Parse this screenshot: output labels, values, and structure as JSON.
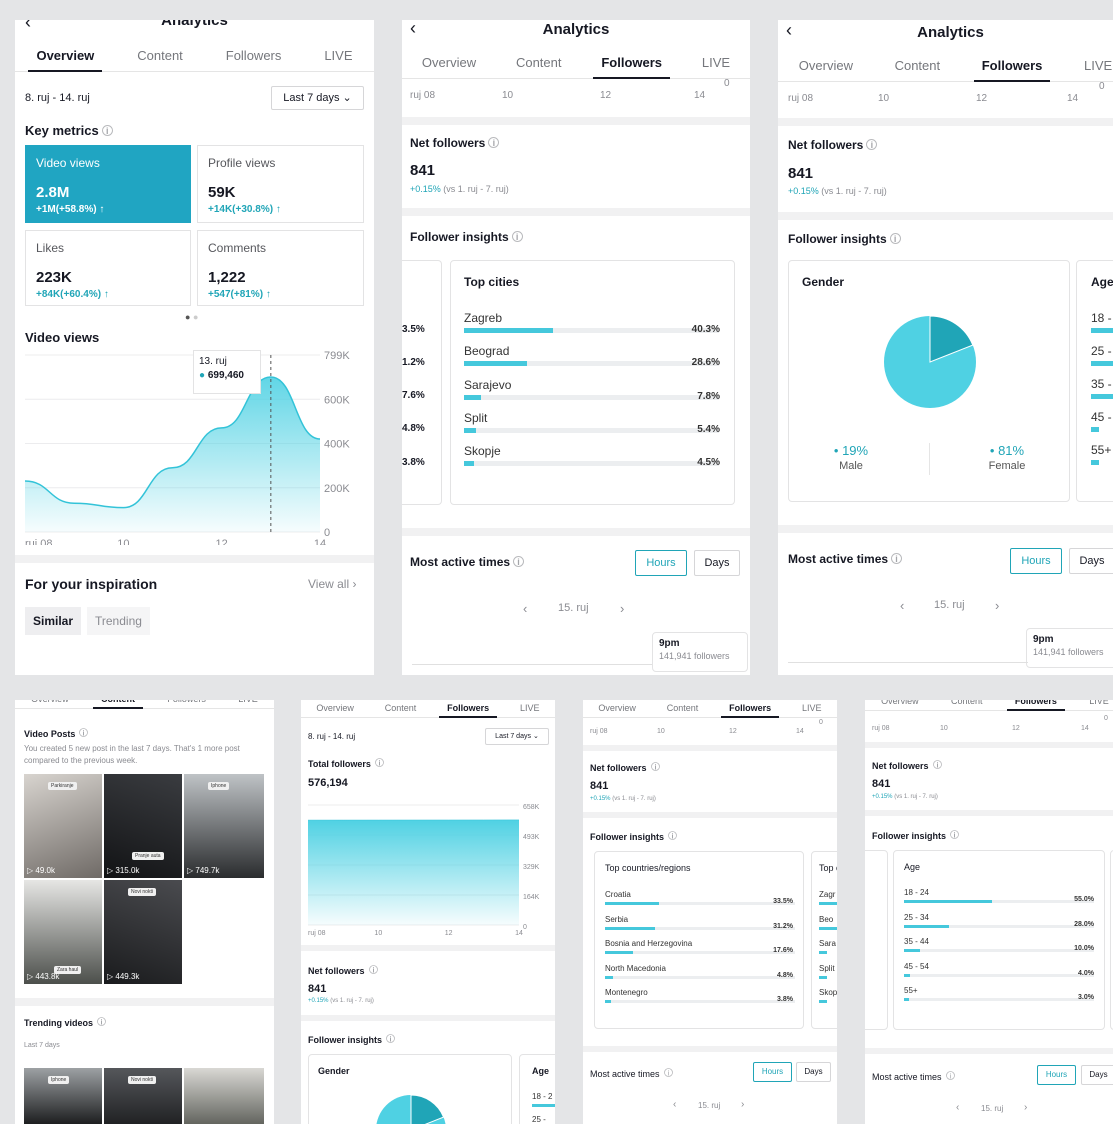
{
  "common": {
    "title": "Analytics",
    "tabs": [
      "Overview",
      "Content",
      "Followers",
      "LIVE"
    ],
    "date_range": "8. ruj - 14. ruj",
    "period_select": "Last 7 days",
    "net_followers_title": "Net followers",
    "net_followers_value": "841",
    "net_followers_pct": "+0.15%",
    "net_followers_vs": " (vs 1. ruj - 7. ruj)",
    "follower_insights_title": "Follower insights",
    "most_active_title": "Most active times",
    "hours_label": "Hours",
    "days_label": "Days",
    "active_date": "15. ruj",
    "active_tooltip_time": "9pm",
    "active_tooltip_followers": "141,941 followers",
    "axis_x": [
      "ruj 08",
      "10",
      "12",
      "14"
    ],
    "axis_zero": "0"
  },
  "overview": {
    "key_metrics_title": "Key metrics",
    "metrics": [
      {
        "label": "Video views",
        "value": "2.8M",
        "change": "+1M(+58.8%) ↑"
      },
      {
        "label": "Profile views",
        "value": "59K",
        "change": "+14K(+30.8%) ↑"
      },
      {
        "label": "Likes",
        "value": "223K",
        "change": "+84K(+60.4%) ↑"
      },
      {
        "label": "Comments",
        "value": "1,222",
        "change": "+547(+81%) ↑"
      }
    ],
    "chart_title": "Video views",
    "y_ticks": [
      "799K",
      "600K",
      "400K",
      "200K",
      "0"
    ],
    "tooltip_date": "13. ruj",
    "tooltip_value": "699,460",
    "inspiration_title": "For your inspiration",
    "view_all": "View all ›",
    "chip_similar": "Similar",
    "chip_trending": "Trending"
  },
  "cities": {
    "title": "Top cities",
    "left_pcts": [
      "3.5%",
      "1.2%",
      "7.6%",
      "4.8%",
      "3.8%"
    ],
    "rows": [
      {
        "name": "Zagreb",
        "pct": "40.3%",
        "share": 0.403
      },
      {
        "name": "Beograd",
        "pct": "28.6%",
        "share": 0.286
      },
      {
        "name": "Sarajevo",
        "pct": "7.8%",
        "share": 0.078
      },
      {
        "name": "Split",
        "pct": "5.4%",
        "share": 0.054
      },
      {
        "name": "Skopje",
        "pct": "4.5%",
        "share": 0.045
      }
    ]
  },
  "gender": {
    "title": "Gender",
    "male_pct": "19%",
    "male_label": "Male",
    "female_pct": "81%",
    "female_label": "Female",
    "male_share": 0.19,
    "age_title": "Age",
    "age_peek": [
      "18 -",
      "25 -",
      "35 -",
      "45 -",
      "55+"
    ]
  },
  "content": {
    "video_posts_title": "Video Posts",
    "video_posts_desc": "You created 5 new post in the last 7 days. That's 1 more post compared to the previous week.",
    "videos": [
      {
        "views": "▷ 49.0k",
        "tag": "Parkiranje"
      },
      {
        "views": "▷ 315.0k",
        "tag": "Pranje auta"
      },
      {
        "views": "▷ 749.7k",
        "tag": "Iphone"
      },
      {
        "views": "▷ 443.8k",
        "tag": "Zara haul"
      },
      {
        "views": "▷ 449.3k",
        "tag": "Novi nokti"
      }
    ],
    "trending_title": "Trending videos",
    "trending_sub": "Last 7 days",
    "trending_tags": [
      "Iphone",
      "Novi nokti",
      ""
    ]
  },
  "total_followers": {
    "title": "Total followers",
    "value": "576,194",
    "y_ticks": [
      "658K",
      "493K",
      "329K",
      "164K",
      "0"
    ],
    "age_peek": [
      "18 - 2",
      "25 -"
    ]
  },
  "countries": {
    "title": "Top countries/regions",
    "rows": [
      {
        "name": "Croatia",
        "pct": "33.5%",
        "share": 0.335
      },
      {
        "name": "Serbia",
        "pct": "31.2%",
        "share": 0.312
      },
      {
        "name": "Bosnia and Herzegovina",
        "pct": "17.6%",
        "share": 0.176
      },
      {
        "name": "North Macedonia",
        "pct": "4.8%",
        "share": 0.048
      },
      {
        "name": "Montenegro",
        "pct": "3.8%",
        "share": 0.038
      }
    ],
    "peek_title": "Top c",
    "peek_rows": [
      "Zagr",
      "Beo",
      "Sara",
      "Split",
      "Skop"
    ]
  },
  "age": {
    "title": "Age",
    "rows": [
      {
        "name": "18 - 24",
        "pct": "55.0%",
        "share": 0.55
      },
      {
        "name": "25 - 34",
        "pct": "28.0%",
        "share": 0.28
      },
      {
        "name": "35 - 44",
        "pct": "10.0%",
        "share": 0.1
      },
      {
        "name": "45 - 54",
        "pct": "4.0%",
        "share": 0.04
      },
      {
        "name": "55+",
        "pct": "3.0%",
        "share": 0.03
      }
    ]
  },
  "chart_data": [
    {
      "type": "area",
      "title": "Video views",
      "x": [
        "ruj 08",
        "9",
        "10",
        "11",
        "12",
        "13",
        "14"
      ],
      "values": [
        230000,
        130000,
        110000,
        290000,
        470000,
        699460,
        420000
      ],
      "ylim": [
        0,
        799000
      ]
    },
    {
      "type": "area",
      "title": "Total followers",
      "x": [
        "ruj 08",
        "9",
        "10",
        "11",
        "12",
        "13",
        "14"
      ],
      "values": [
        575400,
        575520,
        575650,
        575780,
        575900,
        576050,
        576194
      ],
      "ylim": [
        0,
        658000
      ]
    },
    {
      "type": "pie",
      "title": "Gender",
      "categories": [
        "Male",
        "Female"
      ],
      "values": [
        19,
        81
      ]
    }
  ]
}
